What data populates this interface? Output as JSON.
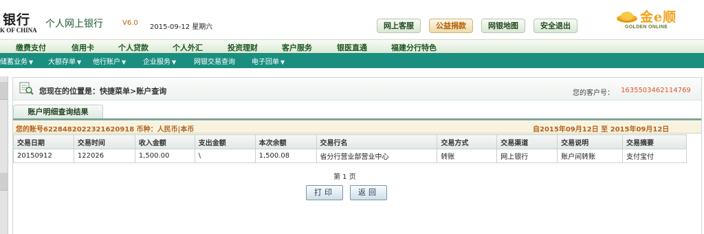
{
  "header": {
    "logo_main": "银行",
    "logo_sub": "K OF CHINA",
    "app_title": "个人网上银行",
    "version": "V6.0",
    "date": "2015-09-12 星期六",
    "buttons": [
      {
        "label": "网上客服"
      },
      {
        "label": "公益捐款"
      },
      {
        "label": "网银地图"
      },
      {
        "label": "安全退出"
      }
    ],
    "brand_text": "金e顺",
    "brand_sub": "GOLDEN ONLINE"
  },
  "nav_primary": [
    "缴费支付",
    "信用卡",
    "个人贷款",
    "个人外汇",
    "投资理财",
    "客户服务",
    "银医直通",
    "福建分行特色"
  ],
  "nav_secondary": [
    "储蓄业务",
    "大额存单",
    "他行账户",
    "企业服务",
    "网银交易查询",
    "电子回单"
  ],
  "location": {
    "text": "您现在的位置是：快捷菜单>账户查询",
    "customer_label": "您的客户号：",
    "customer_no": "1635503462114769"
  },
  "result": {
    "tab_label": "账户明细查询结果",
    "account_info": "您的账号6228482022321620918 币种：人民币|本币",
    "date_range": "自2015年09月12日  至  2015年09月12日"
  },
  "table": {
    "headers": [
      "交易日期",
      "交易时间",
      "收入金额",
      "支出金额",
      "本次余额",
      "交易行名",
      "交易方式",
      "交易渠道",
      "交易说明",
      "交易摘要"
    ],
    "rows": [
      [
        "20150912",
        "122026",
        "1,500.00",
        "\\",
        "1,500.08",
        "省分行营业部营业中心",
        "转账",
        "网上银行",
        "账户间转账",
        "支付宝付"
      ]
    ]
  },
  "pagination": "第 1 页",
  "actions": {
    "print": "打印",
    "back": "返回"
  },
  "colors": {
    "nav_secondary_bg": "#1a8f80",
    "account_text": "#b4621b",
    "customer_no": "#e0542c",
    "brand_gold": "#f0a21a"
  }
}
